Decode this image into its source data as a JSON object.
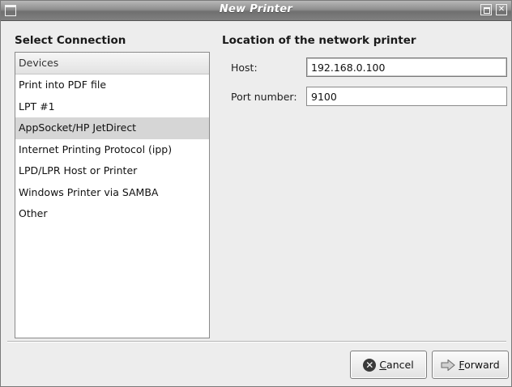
{
  "window": {
    "title": "New Printer"
  },
  "left_panel": {
    "heading": "Select Connection",
    "list_header": "Devices",
    "items": [
      {
        "label": "Print into PDF file"
      },
      {
        "label": "LPT #1"
      },
      {
        "label": "AppSocket/HP JetDirect",
        "selected": true
      },
      {
        "label": "Internet Printing Protocol (ipp)"
      },
      {
        "label": "LPD/LPR Host or Printer"
      },
      {
        "label": "Windows Printer via SAMBA"
      },
      {
        "label": "Other"
      }
    ]
  },
  "right_panel": {
    "heading": "Location of the network printer",
    "host_label": "Host:",
    "host_value": "192.168.0.100",
    "port_label": "Port number:",
    "port_value": "9100"
  },
  "buttons": {
    "cancel_mnemonic": "C",
    "cancel_rest": "ancel",
    "forward_mnemonic": "F",
    "forward_rest": "orward"
  },
  "icons": {
    "window_menu": "window-menu-icon",
    "maximize": "maximize-icon",
    "close": "close-icon",
    "cancel": "cancel-icon",
    "forward": "forward-arrow-icon"
  },
  "colors": {
    "selection": "#d6d6d6",
    "titlebar": "#8e8e8e"
  }
}
